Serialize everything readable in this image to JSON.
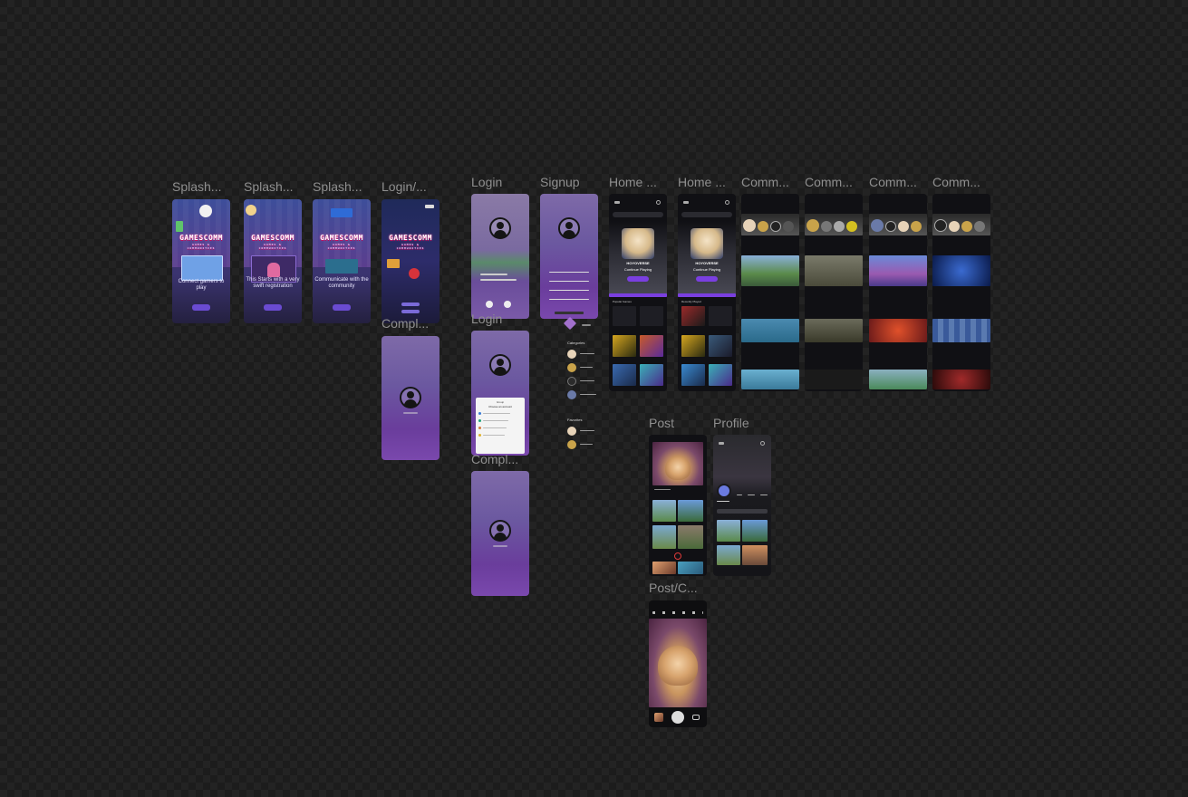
{
  "canvas": {
    "background": "#1c1c1c"
  },
  "frames": {
    "splash1": {
      "label": "Splash...",
      "logo": "GAMESCOMM",
      "tagline": "GAMES & COMMUNITIES",
      "text": "Connect gamers to play"
    },
    "splash2": {
      "label": "Splash...",
      "logo": "GAMESCOMM",
      "tagline": "GAMES & COMMUNITIES",
      "text": "This Starts with a very swift registration"
    },
    "splash3": {
      "label": "Splash...",
      "logo": "GAMESCOMM",
      "tagline": "GAMES & COMMUNITIES",
      "text": "Communicate with the community"
    },
    "login_splash": {
      "label": "Login/...",
      "logo": "GAMESCOMM",
      "tagline": "GAMES & COMMUNITIES"
    },
    "complete1": {
      "label": "Compl..."
    },
    "login": {
      "label": "Login"
    },
    "login2": {
      "label": "Login"
    },
    "complete2": {
      "label": "Compl..."
    },
    "signup": {
      "label": "Signup"
    },
    "home1": {
      "label": "Home ...",
      "publisher": "HOYOVERSE",
      "button": "Continue Playing",
      "section": "Popular Games"
    },
    "home2": {
      "label": "Home ...",
      "publisher": "HOYOVERSE",
      "button": "Continue Playing",
      "section": "Recently Played"
    },
    "comm1": {
      "label": "Comm..."
    },
    "comm2": {
      "label": "Comm..."
    },
    "comm3": {
      "label": "Comm..."
    },
    "comm4": {
      "label": "Comm..."
    },
    "post": {
      "label": "Post"
    },
    "profile": {
      "label": "Profile"
    },
    "post_camera": {
      "label": "Post/C..."
    }
  },
  "sidebar_panel": {
    "categories_label": "Categories",
    "favorites_label": "Favorites"
  },
  "dialog": {
    "title": "Group",
    "subtitle": "Choose an account"
  }
}
